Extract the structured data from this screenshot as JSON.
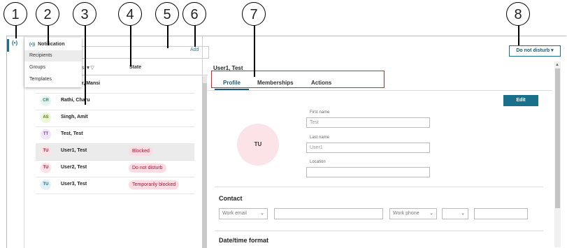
{
  "callouts": [
    "1",
    "2",
    "3",
    "4",
    "5",
    "6",
    "7",
    "8"
  ],
  "rail": {
    "icon": "notification-broadcast-icon",
    "glyph": "(•)"
  },
  "nav_menu": {
    "header": "Notification",
    "header_icon": "(•))",
    "items": [
      "Recipients",
      "Groups",
      "Templates"
    ],
    "selected": "Recipients"
  },
  "toolbar": {
    "add_label": "Add"
  },
  "table": {
    "col_name_fragment": "s ▼▽",
    "col_state": "State",
    "partial_row_name": "r, Mansi",
    "rows": [
      {
        "initials": "CR",
        "name": "Rathi, Charu",
        "state": "",
        "avatar_bg": "#e6f4f1",
        "avatar_fg": "#2b7a6f"
      },
      {
        "initials": "AS",
        "name": "Singh, Amit",
        "state": "",
        "avatar_bg": "#eef5d9",
        "avatar_fg": "#5b7a16"
      },
      {
        "initials": "TT",
        "name": "Test, Test",
        "state": "",
        "avatar_bg": "#f1e6f8",
        "avatar_fg": "#7a3fa0"
      },
      {
        "initials": "TU",
        "name": "User1, Test",
        "state": "Blocked",
        "avatar_bg": "#fbe3e7",
        "avatar_fg": "#b3143a"
      },
      {
        "initials": "TU",
        "name": "User2, Test",
        "state": "Do not disturb",
        "avatar_bg": "#fbe3e7",
        "avatar_fg": "#b3143a"
      },
      {
        "initials": "TU",
        "name": "User3, Test",
        "state": "Temporarily blocked",
        "avatar_bg": "#e2f1f8",
        "avatar_fg": "#1a6f8a"
      }
    ],
    "selected_index": 3
  },
  "status_button": {
    "label": "Do not disturb ▾"
  },
  "detail": {
    "title": "User1, Test",
    "tabs": [
      "Profile",
      "Memberships",
      "Actions"
    ],
    "active_tab": "Profile",
    "edit_label": "Edit",
    "avatar_initials": "TU",
    "fields": [
      {
        "label": "First name",
        "value": "Test"
      },
      {
        "label": "Last name",
        "value": "User1"
      },
      {
        "label": "Location",
        "value": ""
      }
    ],
    "contact": {
      "title": "Contact",
      "email_type": "Work email",
      "phone_type": "Work phone"
    },
    "datetime_title": "Date/time format"
  },
  "colors": {
    "accent": "#1a6f8a",
    "highlight_border": "#e0202a",
    "badge_bg": "#fadde2",
    "badge_fg": "#b3143a"
  }
}
